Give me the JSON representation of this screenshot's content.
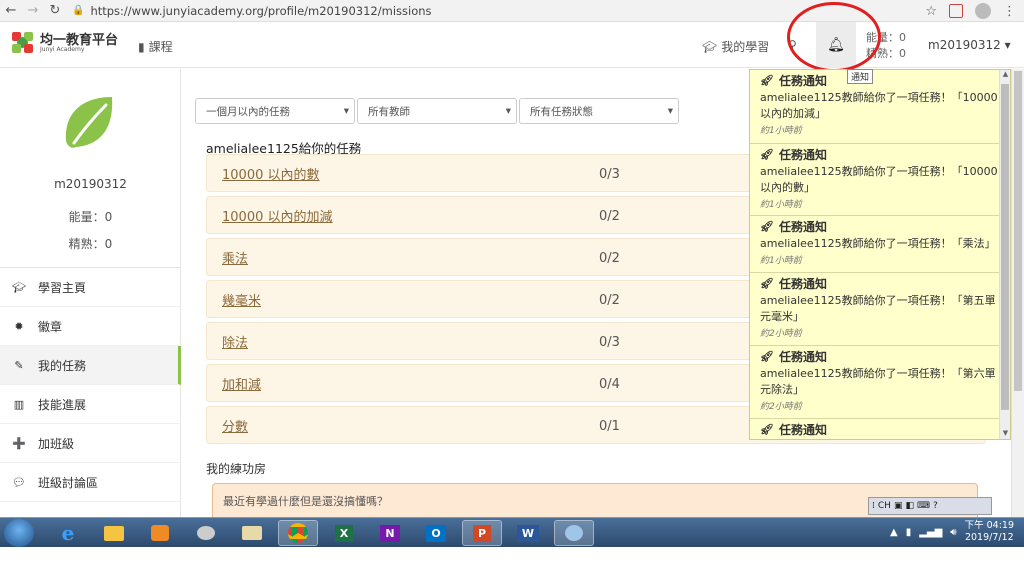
{
  "browser": {
    "url": "https://www.junyiacademy.org/profile/m20190312/missions"
  },
  "header": {
    "logo_title": "均一教育平台",
    "logo_sub": "Junyi Academy",
    "course_label": "課程",
    "my_learning_label": "我的學習",
    "energy_label": "能量：0",
    "mastery_label": "精熟：0",
    "username": "m20190312",
    "tooltip": "通知"
  },
  "sidebar": {
    "username": "m20190312",
    "energy": "能量：0",
    "mastery": "精熟：0",
    "items": [
      {
        "label": "學習主頁",
        "icon": "graduation-cap-icon"
      },
      {
        "label": "徽章",
        "icon": "badge-icon"
      },
      {
        "label": "我的任務",
        "icon": "pencil-icon"
      },
      {
        "label": "技能進展",
        "icon": "bar-chart-icon"
      },
      {
        "label": "加班級",
        "icon": "add-user-icon"
      },
      {
        "label": "班級討論區",
        "icon": "chat-icon"
      }
    ]
  },
  "filters": {
    "time": "一個月以內的任務",
    "teacher": "所有教師",
    "status": "所有任務狀態"
  },
  "missions_title": "amelialee1125給你的任務",
  "missions": [
    {
      "name": "10000 以內的數",
      "progress": "0/3"
    },
    {
      "name": "10000 以內的加減",
      "progress": "0/2"
    },
    {
      "name": "乘法",
      "progress": "0/2"
    },
    {
      "name": "幾毫米",
      "progress": "0/2"
    },
    {
      "name": "除法",
      "progress": "0/3"
    },
    {
      "name": "加和減",
      "progress": "0/4"
    },
    {
      "name": "分數",
      "progress": "0/1"
    }
  ],
  "practice": {
    "title": "我的練功房",
    "text": "最近有學過什麼但是還沒搞懂嗎？"
  },
  "notifications": [
    {
      "title": "任務通知",
      "message": "amelialee1125教師給你了一項任務！「10000以內的加減」",
      "time": "約1小時前"
    },
    {
      "title": "任務通知",
      "message": "amelialee1125教師給你了一項任務！「10000以內的數」",
      "time": "約1小時前"
    },
    {
      "title": "任務通知",
      "message": "amelialee1125教師給你了一項任務！「乘法」",
      "time": "約1小時前"
    },
    {
      "title": "任務通知",
      "message": "amelialee1125教師給你了一項任務！「第五單元毫米」",
      "time": "約2小時前"
    },
    {
      "title": "任務通知",
      "message": "amelialee1125教師給你了一項任務！「第六單元除法」",
      "time": "約2小時前"
    },
    {
      "title": "任務通知",
      "message": "",
      "time": ""
    }
  ],
  "ime": {
    "label": "CH"
  },
  "taskbar": {
    "time": "下午 04:19",
    "date": "2019/7/12"
  },
  "colors": {
    "accent_green": "#8bc34a",
    "notification_bg": "#ffffcc",
    "mission_bg": "#fdf5e6",
    "annotation_red": "#e01f1f"
  }
}
